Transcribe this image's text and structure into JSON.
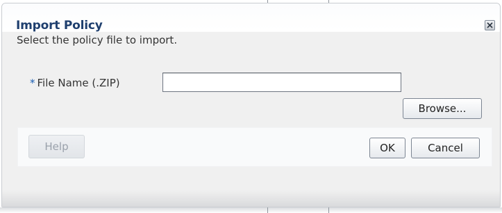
{
  "dialog": {
    "title": "Import Policy",
    "close_icon": "close-icon",
    "instruction": "Select the policy file to import.",
    "file_field": {
      "required_marker": "*",
      "label": "File Name (.ZIP)",
      "value": "",
      "placeholder": ""
    },
    "browse_label": "Browse...",
    "buttons": {
      "help_label": "Help",
      "ok_label": "OK",
      "cancel_label": "Cancel"
    }
  },
  "colors": {
    "title": "#1f3f6e",
    "required_marker": "#1b5fb4",
    "dialog_background": "#f0f0f0",
    "button_bar_background": "#f9fafb",
    "disabled_text": "#9aa1ab"
  }
}
